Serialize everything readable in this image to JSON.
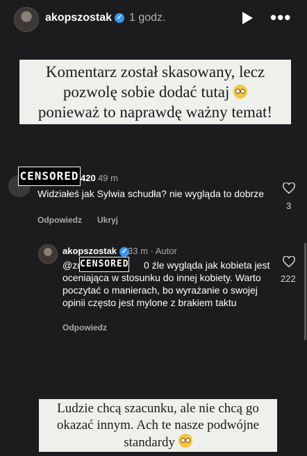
{
  "header": {
    "username": "akopszostak",
    "time": "1 godz.",
    "verified_mark": "✓",
    "more_label": "•••"
  },
  "caption_top": {
    "line1": "Komentarz został skasowany, lecz",
    "line2": "pozwolę sobie dodać tutaj",
    "line3": "ponieważ to naprawdę ważny temat!"
  },
  "comment": {
    "censor_label": "CENSORED",
    "username_suffix": "420",
    "time": "49 m",
    "text": "Widziałeś jak Sylwia schudła? nie wygląda to dobrze",
    "reply_label": "Odpowiedz",
    "hide_label": "Ukryj",
    "likes": "3"
  },
  "reply": {
    "username": "akopszostak",
    "time": "33 m · Autor",
    "mention_prefix": "@zu",
    "censor_label": "CENSORED",
    "mention_suffix": "0",
    "text": " źle wygląda jak kobieta jest oceniająca w stosunku do innej kobiety. Warto poczytać o manierach, bo wyrażanie o swojej opinii często jest mylone z brakiem taktu",
    "reply_label": "Odpowiedz",
    "likes": "222"
  },
  "caption_bottom": {
    "line1": "Ludzie chcą szacunku, ale nie chcą go",
    "line2": "okazać innym. Ach te nasze podwójne",
    "line3": "standardy"
  },
  "colors": {
    "background": "#1c1c1e",
    "verified": "#3897f0",
    "caption_bg": "#eef0ec"
  },
  "icons": [
    "avatar",
    "verified-icon",
    "play-icon",
    "more-icon",
    "heart-icon",
    "emoji-icon"
  ]
}
